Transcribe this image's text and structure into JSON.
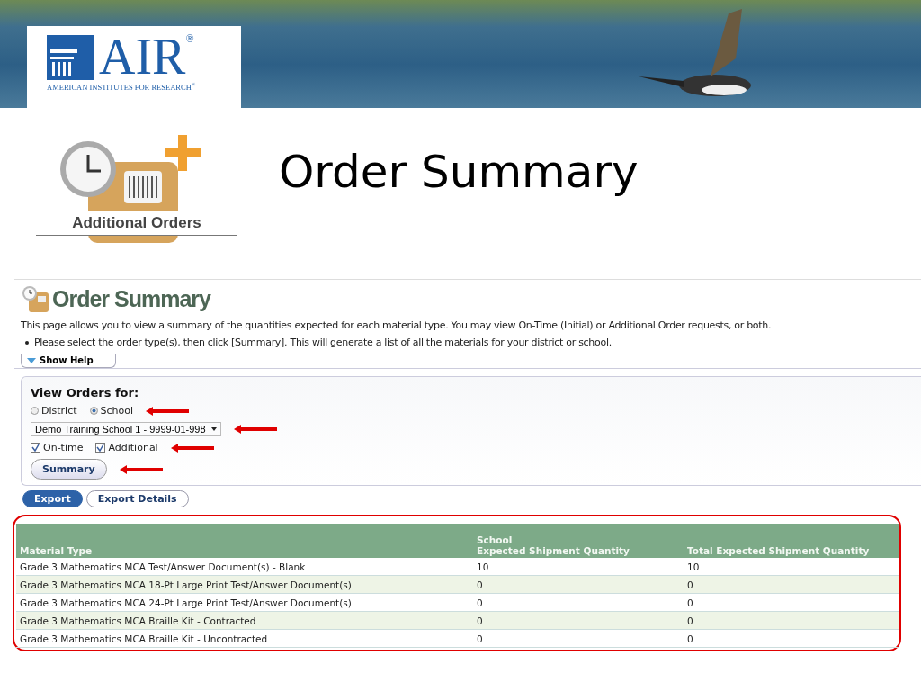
{
  "banner": {
    "logo_text": "AIR$^{®}$",
    "logo_subtitle": "AMERICAN INSTITUTES FOR RESEARCH$^{®}$"
  },
  "slide": {
    "icon_caption": "Additional Orders",
    "title": "Order Summary"
  },
  "page": {
    "heading": "Order Summary",
    "intro": "This page allows you to view a summary of the quantities expected for each material type. You may view On-Time (Initial) or Additional Order requests, or both.",
    "bullet": "Please select the order type(s), then click [Summary]. This will generate a list of all the materials for your district or school.",
    "help_toggle": "Show Help"
  },
  "filter": {
    "heading": "View Orders for:",
    "radios": [
      {
        "label": "District",
        "selected": false
      },
      {
        "label": "School",
        "selected": true
      }
    ],
    "dropdown": {
      "value": "Demo Training School 1 - 9999-01-998"
    },
    "checkboxes": [
      {
        "label": "On-time",
        "checked": true
      },
      {
        "label": "Additional",
        "checked": true
      }
    ],
    "submit": "Summary"
  },
  "actions": [
    {
      "label": "Export",
      "kind": "primary"
    },
    {
      "label": "Export Details",
      "kind": "secondary"
    }
  ],
  "table": {
    "columns": [
      {
        "label": "Material Type"
      },
      {
        "group": "School",
        "label": "Expected Shipment Quantity"
      },
      {
        "label": "Total Expected Shipment Quantity"
      }
    ],
    "rows": [
      [
        "Grade 3 Mathematics MCA Test/Answer Document(s) - Blank",
        "10",
        "10"
      ],
      [
        "Grade 3 Mathematics MCA 18-Pt Large Print Test/Answer Document(s)",
        "0",
        "0"
      ],
      [
        "Grade 3 Mathematics MCA 24-Pt Large Print Test/Answer Document(s)",
        "0",
        "0"
      ],
      [
        "Grade 3 Mathematics MCA Braille Kit - Contracted",
        "0",
        "0"
      ],
      [
        "Grade 3 Mathematics MCA Braille Kit - Uncontracted",
        "0",
        "0"
      ]
    ]
  }
}
